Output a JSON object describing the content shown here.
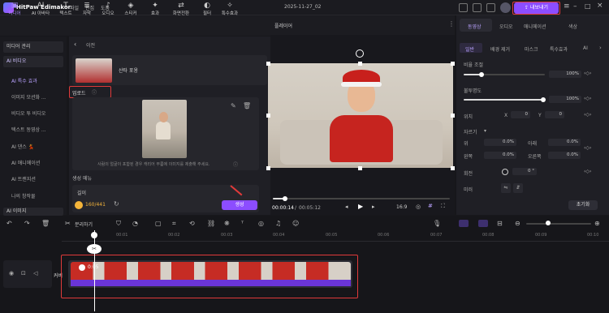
{
  "titlebar": {
    "app_name": "HitPaw Edimakor",
    "menu": [
      "파일",
      "편집",
      "도움"
    ],
    "document_title": "2025-11-27_02",
    "export_label": "내보내기"
  },
  "toolbar": {
    "tools": [
      {
        "icon": "media-icon",
        "label": "미디어"
      },
      {
        "icon": "ai-icon",
        "label": "AI 아바타"
      },
      {
        "icon": "text-icon",
        "label": "텍스트"
      },
      {
        "icon": "subtitle-icon",
        "label": "자막"
      },
      {
        "icon": "audio-icon",
        "label": "오디오"
      },
      {
        "icon": "sticker-icon",
        "label": "스티커"
      },
      {
        "icon": "effect-icon",
        "label": "효과"
      },
      {
        "icon": "transition-icon",
        "label": "화면전환"
      },
      {
        "icon": "filter-icon",
        "label": "필터"
      },
      {
        "icon": "special-icon",
        "label": "특수효과"
      }
    ]
  },
  "leftnav": {
    "groups": [
      "미디어 관리",
      "AI 비디오",
      "AI 이미지"
    ],
    "items": [
      "AI 특수 효과",
      "이미지 모션화 ...",
      "비디오 투 비디오",
      "텍스트 동영상 ...",
      "AI 댄스 💃",
      "AI 애니메이션",
      "AI 트랜지션",
      "나의 창작물"
    ]
  },
  "panel": {
    "back_label": "이전",
    "template_name": "산타 포옹",
    "upload_label": "업로드",
    "upload_hint": "사람의 얼굴이 포함된 경우 캐리어 무릎에 이미지를 제출해 주세요.",
    "generate_section": "생성 메뉴",
    "length_label": "길이",
    "credits": "160/441",
    "generate_button": "생성"
  },
  "player": {
    "header": "플레이어",
    "current_time": "00:00:14",
    "total_time": "00:05:12",
    "aspect": "16:9"
  },
  "right_panel": {
    "tabs": [
      "동영상",
      "오디오",
      "애니메이션",
      "색상"
    ],
    "subtabs": [
      "일반",
      "배경 제거",
      "마스크",
      "특수효과",
      "AI"
    ],
    "scale_label": "비율 조절",
    "scale_value": "100%",
    "opacity_label": "불투명도",
    "opacity_value": "100%",
    "position_label": "위치",
    "pos_x": "0",
    "pos_y": "0",
    "crop_label": "자르기",
    "crop": [
      {
        "label": "위",
        "value": "0.0%"
      },
      {
        "label": "아래",
        "value": "0.0%"
      },
      {
        "label": "왼쪽",
        "value": "0.0%"
      },
      {
        "label": "오른쪽",
        "value": "0.0%"
      }
    ],
    "rotate_label": "회전",
    "rotate_value": "0 °",
    "mirror_label": "미러",
    "reset_button": "초기화"
  },
  "timeline": {
    "split_label": "분리하기",
    "ticks": [
      "00:01",
      "00:02",
      "00:03",
      "00:04",
      "00:05",
      "00:06",
      "00:07",
      "00:08",
      "00:09",
      "00:10"
    ],
    "clip_duration": "0:05",
    "track_label": "커버"
  },
  "colors": {
    "accent": "#8c4dff",
    "highlight": "#e03a3a"
  }
}
